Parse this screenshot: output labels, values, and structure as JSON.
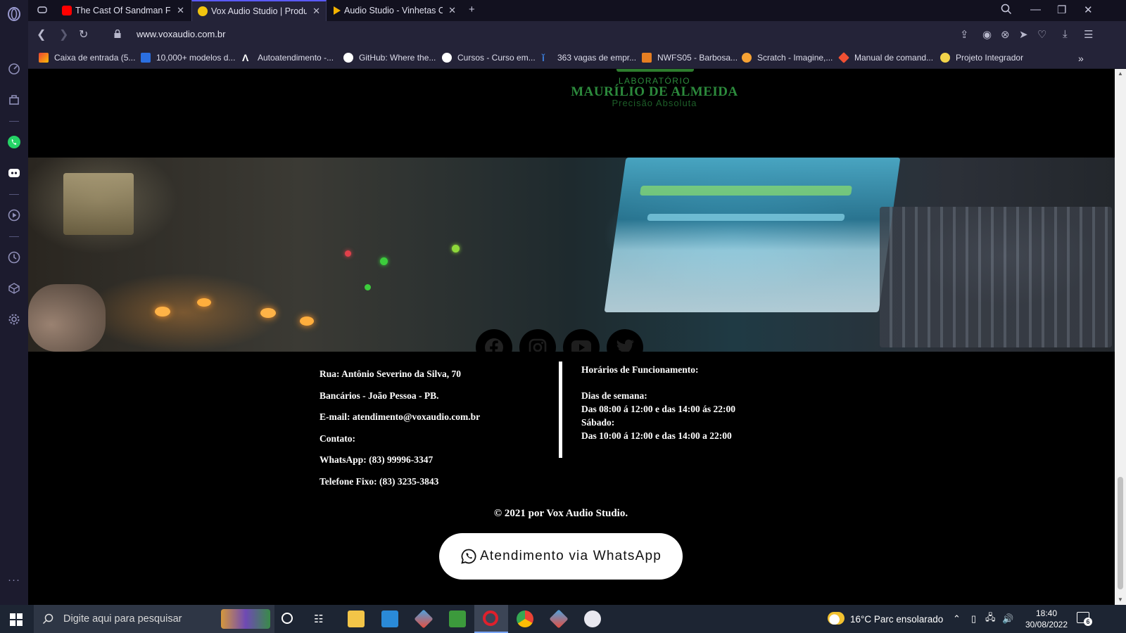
{
  "browser": {
    "tabs": [
      {
        "title": "The Cast Of Sandman Finds",
        "active": false
      },
      {
        "title": "Vox Audio Studio | Produto",
        "active": true
      },
      {
        "title": "Audio Studio - Vinhetas Ca",
        "active": false
      }
    ],
    "url": "www.voxaudio.com.br",
    "bookmarks": [
      "Caixa de entrada (5...",
      "10,000+ modelos d...",
      "Autoatendimento -...",
      "GitHub: Where the...",
      "Cursos - Curso em...",
      "363 vagas de empr...",
      "NWFS05 - Barbosa...",
      "Scratch - Imagine,...",
      "Manual de comand...",
      "Projeto Integrador"
    ]
  },
  "page": {
    "logo": {
      "line1": "LABORATÓRIO",
      "line2": "MAURÍLIO DE ALMEIDA",
      "line3": "Precisão Absoluta"
    },
    "social": [
      "facebook",
      "instagram",
      "youtube",
      "twitter"
    ],
    "address": {
      "street": "Rua: Antônio Severino da Silva, 70",
      "district": "Bancários - João Pessoa - PB.",
      "email": "E-mail: atendimento@voxaudio.com.br",
      "contact": "Contato:",
      "whatsapp": "WhatsApp: (83) 99996-3347",
      "phone": "Telefone Fixo: (83) 3235-3843"
    },
    "hours": {
      "title": "Horários de Funcionamento:",
      "weekdays_label": "Dias de semana:",
      "weekdays": "Das 08:00 á 12:00 e das 14:00 ás 22:00",
      "saturday_label": "Sábado:",
      "saturday": "Das 10:00 á 12:00 e das 14:00 a 22:00"
    },
    "copyright": "© 2021 por Vox Audio Studio.",
    "whatsapp_button": "Atendimento via WhatsApp"
  },
  "taskbar": {
    "search_placeholder": "Digite aqui para pesquisar",
    "weather": "16°C  Parc ensolarado",
    "time": "18:40",
    "date": "30/08/2022",
    "notifications": "6"
  },
  "colors": {
    "accent": "#5a5aff",
    "logo_green": "#2c8a3c",
    "page_bg": "#000000"
  }
}
